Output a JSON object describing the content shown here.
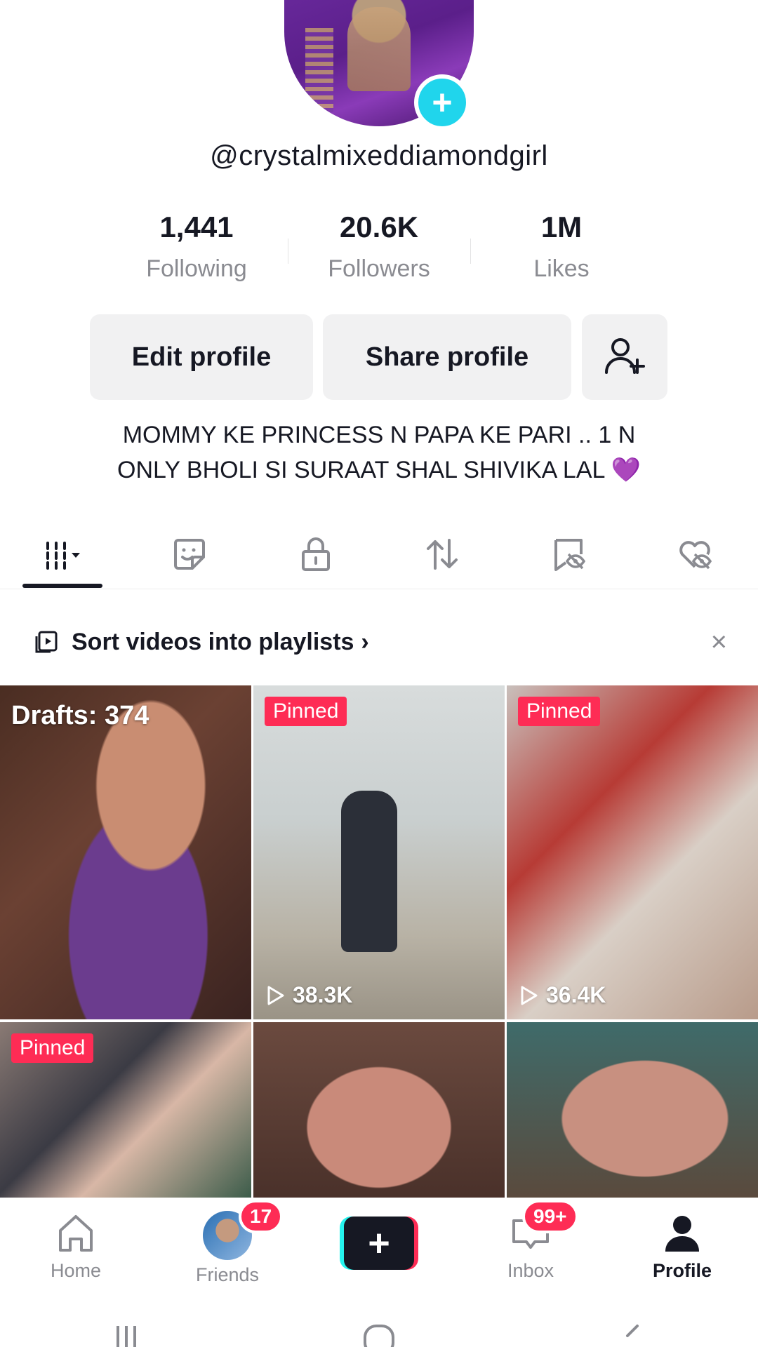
{
  "profile": {
    "username": "@crystalmixeddiamondgirl",
    "bio_line1": "MOMMY KE PRINCESS N PAPA KE PARI .. 1 N",
    "bio_line2": "ONLY BHOLI SI SURAAT SHAL SHIVIKA LAL 💜"
  },
  "stats": [
    {
      "value": "1,441",
      "label": "Following"
    },
    {
      "value": "20.6K",
      "label": "Followers"
    },
    {
      "value": "1M",
      "label": "Likes"
    }
  ],
  "buttons": {
    "edit": "Edit profile",
    "share": "Share profile"
  },
  "playlist_prompt": {
    "text": "Sort videos into playlists",
    "chevron": "›",
    "close": "×"
  },
  "grid": {
    "drafts": "Drafts: 374",
    "pinned": "Pinned",
    "views_2": "38.3K",
    "views_3": "36.4K"
  },
  "nav": {
    "home": "Home",
    "friends": "Friends",
    "friends_badge": "17",
    "create": "+",
    "inbox": "Inbox",
    "inbox_badge": "99+",
    "profile": "Profile"
  },
  "colors": {
    "accent": "#fe2c55",
    "cyan": "#20d5ec",
    "text": "#161823",
    "muted": "#8a8b91"
  }
}
